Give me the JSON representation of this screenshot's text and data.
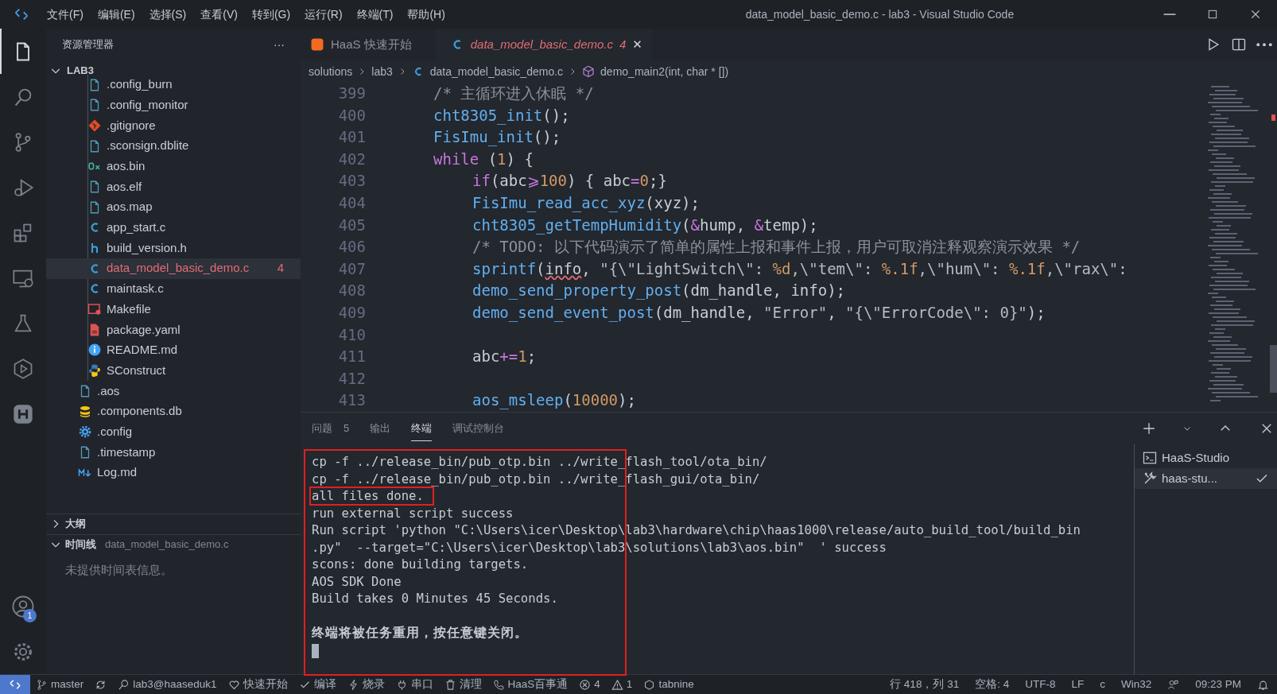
{
  "window": {
    "title": "data_model_basic_demo.c - lab3 - Visual Studio Code"
  },
  "menu": [
    "文件(F)",
    "编辑(E)",
    "选择(S)",
    "查看(V)",
    "转到(G)",
    "运行(R)",
    "终端(T)",
    "帮助(H)"
  ],
  "activity_bar": [
    {
      "kind": "files",
      "selected": true
    },
    {
      "kind": "search",
      "selected": false
    },
    {
      "kind": "branch",
      "selected": false
    },
    {
      "kind": "debug",
      "selected": false
    },
    {
      "kind": "extensions",
      "selected": false
    },
    {
      "kind": "remote",
      "selected": false
    },
    {
      "kind": "flask",
      "selected": false
    },
    {
      "kind": "hexplay",
      "selected": false
    },
    {
      "kind": "hlogo",
      "selected": false
    }
  ],
  "account_badge": "1",
  "sidebar": {
    "title": "资源管理器",
    "more": "···",
    "root": {
      "label": "LAB3",
      "expanded": true,
      "children": [
        {
          "kind": "group",
          "children": [
            {
              "label": ".config_burn",
              "kind": "file",
              "selected": false,
              "error": false
            },
            {
              "label": ".config_monitor",
              "kind": "file",
              "selected": false,
              "error": false
            },
            {
              "label": ".gitignore",
              "kind": "git",
              "selected": false,
              "error": false
            },
            {
              "label": ".sconsign.dblite",
              "kind": "file",
              "selected": false,
              "error": false
            },
            {
              "label": "aos.bin",
              "kind": "hex",
              "selected": false,
              "error": false
            },
            {
              "label": "aos.elf",
              "kind": "file",
              "selected": false,
              "error": false
            },
            {
              "label": "aos.map",
              "kind": "file",
              "selected": false,
              "error": false
            },
            {
              "label": "app_start.c",
              "kind": "c",
              "selected": false,
              "error": false
            },
            {
              "label": "build_version.h",
              "kind": "h",
              "selected": false,
              "error": false
            },
            {
              "label": "data_model_basic_demo.c",
              "kind": "c",
              "selected": true,
              "error": true,
              "problems": "4"
            },
            {
              "label": "maintask.c",
              "kind": "c",
              "selected": false,
              "error": false
            },
            {
              "label": "Makefile",
              "kind": "make",
              "selected": false,
              "error": false
            },
            {
              "label": "package.yaml",
              "kind": "yaml",
              "selected": false,
              "error": false
            },
            {
              "label": "README.md",
              "kind": "info",
              "selected": false,
              "error": false
            },
            {
              "label": "SConstruct",
              "kind": "python",
              "selected": false,
              "error": false
            }
          ]
        },
        {
          "label": ".aos",
          "kind": "file",
          "selected": false,
          "error": false
        },
        {
          "label": ".components.db",
          "kind": "db",
          "selected": false,
          "error": false
        },
        {
          "label": ".config",
          "kind": "gear",
          "selected": false,
          "error": false
        },
        {
          "label": ".timestamp",
          "kind": "file",
          "selected": false,
          "error": false
        },
        {
          "label": "Log.md",
          "kind": "md",
          "selected": false,
          "error": false
        }
      ]
    },
    "sections": [
      {
        "label": "大纲",
        "expanded": false
      },
      {
        "label": "时间线",
        "expanded": true,
        "detail": "data_model_basic_demo.c",
        "message": "未提供时间表信息。"
      }
    ]
  },
  "tabs": [
    {
      "label": "HaaS 快速开始",
      "kind": "haas",
      "selected": false
    },
    {
      "label": "data_model_basic_demo.c",
      "kind": "c",
      "selected": true,
      "problems": "4",
      "close": "✕"
    }
  ],
  "breadcrumbs": [
    {
      "label": "solutions"
    },
    {
      "label": "lab3"
    },
    {
      "label": "data_model_basic_demo.c",
      "kind": "c"
    },
    {
      "label": "demo_main2(int, char * [])",
      "kind": "cube"
    }
  ],
  "code": [
    {
      "number": "399",
      "kind": "outer",
      "tokens": [
        {
          "text": "/* 主循环进入休眠 */",
          "kind": "cmt"
        }
      ]
    },
    {
      "number": "400",
      "kind": "outer",
      "tokens": [
        {
          "text": "cht8305_init",
          "kind": "fn"
        },
        {
          "text": "();",
          "kind": "txt"
        }
      ]
    },
    {
      "number": "401",
      "kind": "outer",
      "tokens": [
        {
          "text": "FisImu_init",
          "kind": "fn"
        },
        {
          "text": "();",
          "kind": "txt"
        }
      ]
    },
    {
      "number": "402",
      "kind": "outer",
      "tokens": [
        {
          "text": "while",
          "kind": "kw"
        },
        {
          "text": " (",
          "kind": "txt"
        },
        {
          "text": "1",
          "kind": "num"
        },
        {
          "text": ") {",
          "kind": "txt"
        }
      ]
    },
    {
      "number": "403",
      "kind": "inner",
      "tokens": [
        {
          "text": "if",
          "kind": "kw"
        },
        {
          "text": "(abc",
          "kind": "txt"
        },
        {
          "text": "⩾",
          "kind": "op"
        },
        {
          "text": "100",
          "kind": "num"
        },
        {
          "text": ") { abc",
          "kind": "txt"
        },
        {
          "text": "=",
          "kind": "op"
        },
        {
          "text": "0",
          "kind": "num"
        },
        {
          "text": ";}",
          "kind": "txt"
        }
      ]
    },
    {
      "number": "404",
      "kind": "inner",
      "tokens": [
        {
          "text": "FisImu_read_acc_xyz",
          "kind": "fn"
        },
        {
          "text": "(xyz);",
          "kind": "txt"
        }
      ]
    },
    {
      "number": "405",
      "kind": "inner",
      "tokens": [
        {
          "text": "cht8305_getTempHumidity",
          "kind": "fn"
        },
        {
          "text": "(",
          "kind": "txt"
        },
        {
          "text": "&",
          "kind": "op"
        },
        {
          "text": "hump, ",
          "kind": "txt"
        },
        {
          "text": "&",
          "kind": "op"
        },
        {
          "text": "temp);",
          "kind": "txt"
        }
      ]
    },
    {
      "number": "406",
      "kind": "inner",
      "tokens": [
        {
          "text": "/* TODO: 以下代码演示了简单的属性上报和事件上报，用户可取消注释观察演示效果 */",
          "kind": "cmt"
        }
      ]
    },
    {
      "number": "407",
      "kind": "inner",
      "tokens": [
        {
          "text": "sprintf",
          "kind": "fn"
        },
        {
          "text": "(",
          "kind": "txt"
        },
        {
          "text": "info",
          "kind": "warn"
        },
        {
          "text": ", ",
          "kind": "txt"
        },
        {
          "text": "\"{\\\"LightSwitch\\\": ",
          "kind": "str"
        },
        {
          "text": "%d",
          "kind": "fmt"
        },
        {
          "text": ",\\\"tem\\\": ",
          "kind": "str"
        },
        {
          "text": "%.1f",
          "kind": "fmt"
        },
        {
          "text": ",\\\"hum\\\": ",
          "kind": "str"
        },
        {
          "text": "%.1f",
          "kind": "fmt"
        },
        {
          "text": ",\\\"rax\\\": ",
          "kind": "str"
        }
      ]
    },
    {
      "number": "408",
      "kind": "inner",
      "tokens": [
        {
          "text": "demo_send_property_post",
          "kind": "fn"
        },
        {
          "text": "(dm_handle, info);",
          "kind": "txt"
        }
      ]
    },
    {
      "number": "409",
      "kind": "inner",
      "tokens": [
        {
          "text": "demo_send_event_post",
          "kind": "fn"
        },
        {
          "text": "(dm_handle, ",
          "kind": "txt"
        },
        {
          "text": "\"Error\"",
          "kind": "str"
        },
        {
          "text": ", ",
          "kind": "txt"
        },
        {
          "text": "\"{\\\"ErrorCode\\\": 0}\"",
          "kind": "str"
        },
        {
          "text": ");",
          "kind": "txt"
        }
      ]
    },
    {
      "number": "410",
      "kind": "blank"
    },
    {
      "number": "411",
      "kind": "inner",
      "tokens": [
        {
          "text": "abc",
          "kind": "txt"
        },
        {
          "text": "+=",
          "kind": "op"
        },
        {
          "text": "1",
          "kind": "num"
        },
        {
          "text": ";",
          "kind": "txt"
        }
      ]
    },
    {
      "number": "412",
      "kind": "blank"
    },
    {
      "number": "413",
      "kind": "inner",
      "tokens": [
        {
          "text": "aos_msleep",
          "kind": "fn"
        },
        {
          "text": "(",
          "kind": "txt"
        },
        {
          "text": "10000",
          "kind": "num"
        },
        {
          "text": ");",
          "kind": "txt"
        }
      ]
    }
  ],
  "panel": {
    "tabs": [
      {
        "label": "问题",
        "badge": "5",
        "selected": false
      },
      {
        "label": "输出",
        "selected": false
      },
      {
        "label": "终端",
        "selected": true
      },
      {
        "label": "调试控制台",
        "selected": false
      }
    ],
    "terminal": {
      "framed": true,
      "cursor": true,
      "lines": [
        {
          "kind": "text",
          "text": "cp -f ../release_bin/pub_otp.bin ../write_flash_tool/ota_bin/",
          "boxed": false
        },
        {
          "kind": "text",
          "text": "cp -f ../release_bin/pub_otp.bin ../write_flash_gui/ota_bin/",
          "boxed": false
        },
        {
          "kind": "text",
          "text": "all files done.",
          "boxed": true
        },
        {
          "kind": "text",
          "text": "run external script success",
          "boxed": false
        },
        {
          "kind": "text",
          "text": "Run script 'python \"C:\\Users\\icer\\Desktop\\lab3\\hardware\\chip\\haas1000\\release/auto_build_tool/build_bin",
          "boxed": false
        },
        {
          "kind": "text",
          "text": ".py\"  --target=\"C:\\Users\\icer\\Desktop\\lab3\\solutions\\lab3\\aos.bin\"  ' success",
          "boxed": false
        },
        {
          "kind": "text",
          "text": "scons: done building targets.",
          "boxed": false
        },
        {
          "kind": "text",
          "text": "AOS SDK Done",
          "boxed": false
        },
        {
          "kind": "text",
          "text": "Build takes 0 Minutes 45 Seconds.",
          "boxed": false
        },
        {
          "kind": "blank"
        },
        {
          "kind": "notice",
          "text": "终端将被任务重用，按任意键关闭。",
          "boxed": false
        }
      ]
    },
    "terminals": [
      {
        "label": "HaaS-Studio",
        "kind": "terminal",
        "selected": false,
        "done": false
      },
      {
        "label": "haas-stu...",
        "kind": "tools",
        "selected": true,
        "done": true
      }
    ]
  },
  "status_bar": {
    "left": [
      {
        "kind": "branch",
        "text": "master"
      },
      {
        "kind": "sync"
      },
      {
        "kind": "user",
        "text": "lab3@haaseduk1"
      },
      {
        "kind": "heart",
        "text": "快速开始"
      },
      {
        "kind": "check",
        "text": "编译"
      },
      {
        "kind": "bolt",
        "text": "烧录"
      },
      {
        "kind": "plug",
        "text": "串口"
      },
      {
        "kind": "trash",
        "text": "清理"
      },
      {
        "kind": "phone",
        "text": "HaaS百事通"
      },
      {
        "kind": "error",
        "text": "4"
      },
      {
        "kind": "warning",
        "text": "1"
      },
      {
        "kind": "hexsmall",
        "text": "tabnine"
      }
    ],
    "right": [
      {
        "text": "行 418，列 31"
      },
      {
        "text": "空格: 4"
      },
      {
        "text": "UTF-8"
      },
      {
        "text": "LF"
      },
      {
        "text": "c"
      },
      {
        "text": "Win32"
      },
      {
        "kind": "feedback"
      },
      {
        "text": "09:23 PM"
      },
      {
        "kind": "bell"
      }
    ]
  }
}
